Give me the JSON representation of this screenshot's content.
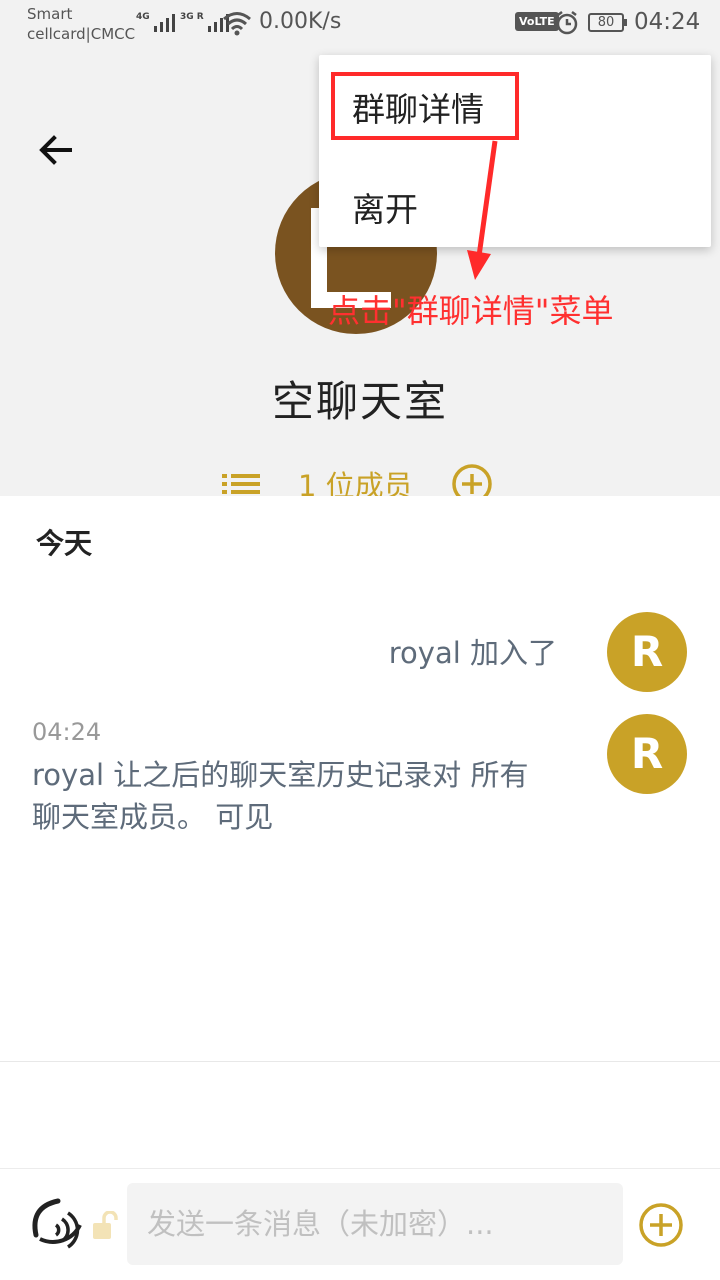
{
  "status_bar": {
    "carrier_line1": "Smart",
    "carrier_line2": "cellcard|CMCC",
    "net1": "4G",
    "net2": "3G R",
    "speed": "0.00K/s",
    "volte": "VoLTE",
    "battery": "80",
    "time": "04:24"
  },
  "header": {
    "room_name": "空聊天室",
    "members_label": "1 位成员"
  },
  "menu": {
    "items": [
      "群聊详情",
      "离开"
    ]
  },
  "annotation": {
    "text": "点击\"群聊详情\"菜单"
  },
  "chat": {
    "date_separator": "今天",
    "avatar_letter": "R",
    "join_notice": "royal 加入了",
    "message": {
      "time": "04:24",
      "text": "royal 让之后的聊天室历史记录对 所有聊天室成员。 可见"
    }
  },
  "composer": {
    "placeholder": "发送一条消息（未加密）..."
  },
  "colors": {
    "accent": "#c9a227",
    "avatar_brown": "#7a5320",
    "annotation_red": "#ff2a2a",
    "message_text": "#5e6b7a"
  }
}
